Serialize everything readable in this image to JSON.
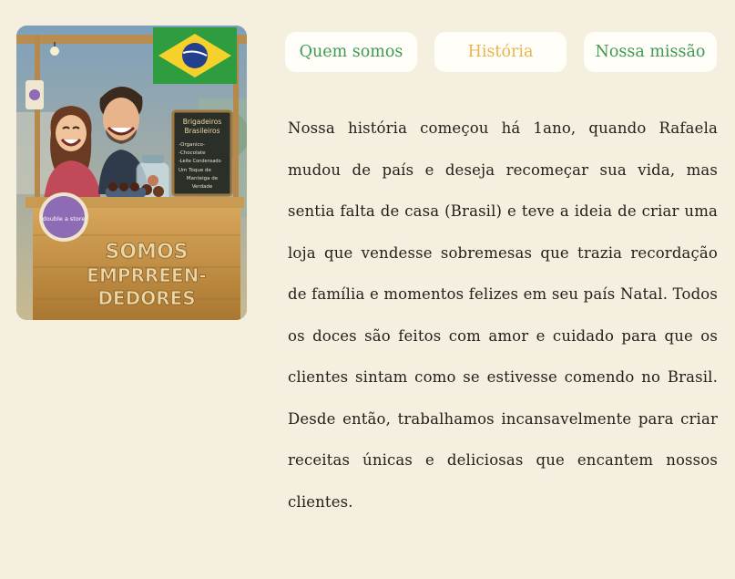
{
  "hero_image": {
    "flag_colors": {
      "green": "#2f9d3f",
      "yellow": "#f5d12b",
      "blue": "#253f8f"
    },
    "chalkboard_lines": [
      "Brigadeiros",
      "Brasileiros",
      "-Organico-",
      "-Chocolate",
      "-Leite Condensado",
      "Um Toque de",
      "Manteiga de",
      "Verdade"
    ],
    "badge_text": "double a store",
    "sign_lines": [
      "SOMOS",
      "EMPRREEN-",
      "DEDORES"
    ]
  },
  "tabs": [
    {
      "label": "Quem somos",
      "active": false
    },
    {
      "label": "História",
      "active": true
    },
    {
      "label": "Nossa missão",
      "active": false
    }
  ],
  "story": {
    "text": "Nossa história começou há 1ano, quando Rafaela mudou de país e deseja recomeçar sua vida, mas sentia falta de casa (Brasil) e teve a ideia de criar uma loja que vendesse sobremesas que trazia recordação de família e momentos felizes em seu país Natal. Todos os doces são feitos com amor e cuidado para que os clientes sintam como se estivesse comendo no Brasil. Desde então, trabalhamos incansavelmente para criar receitas únicas e deliciosas que encantem nossos clientes."
  }
}
